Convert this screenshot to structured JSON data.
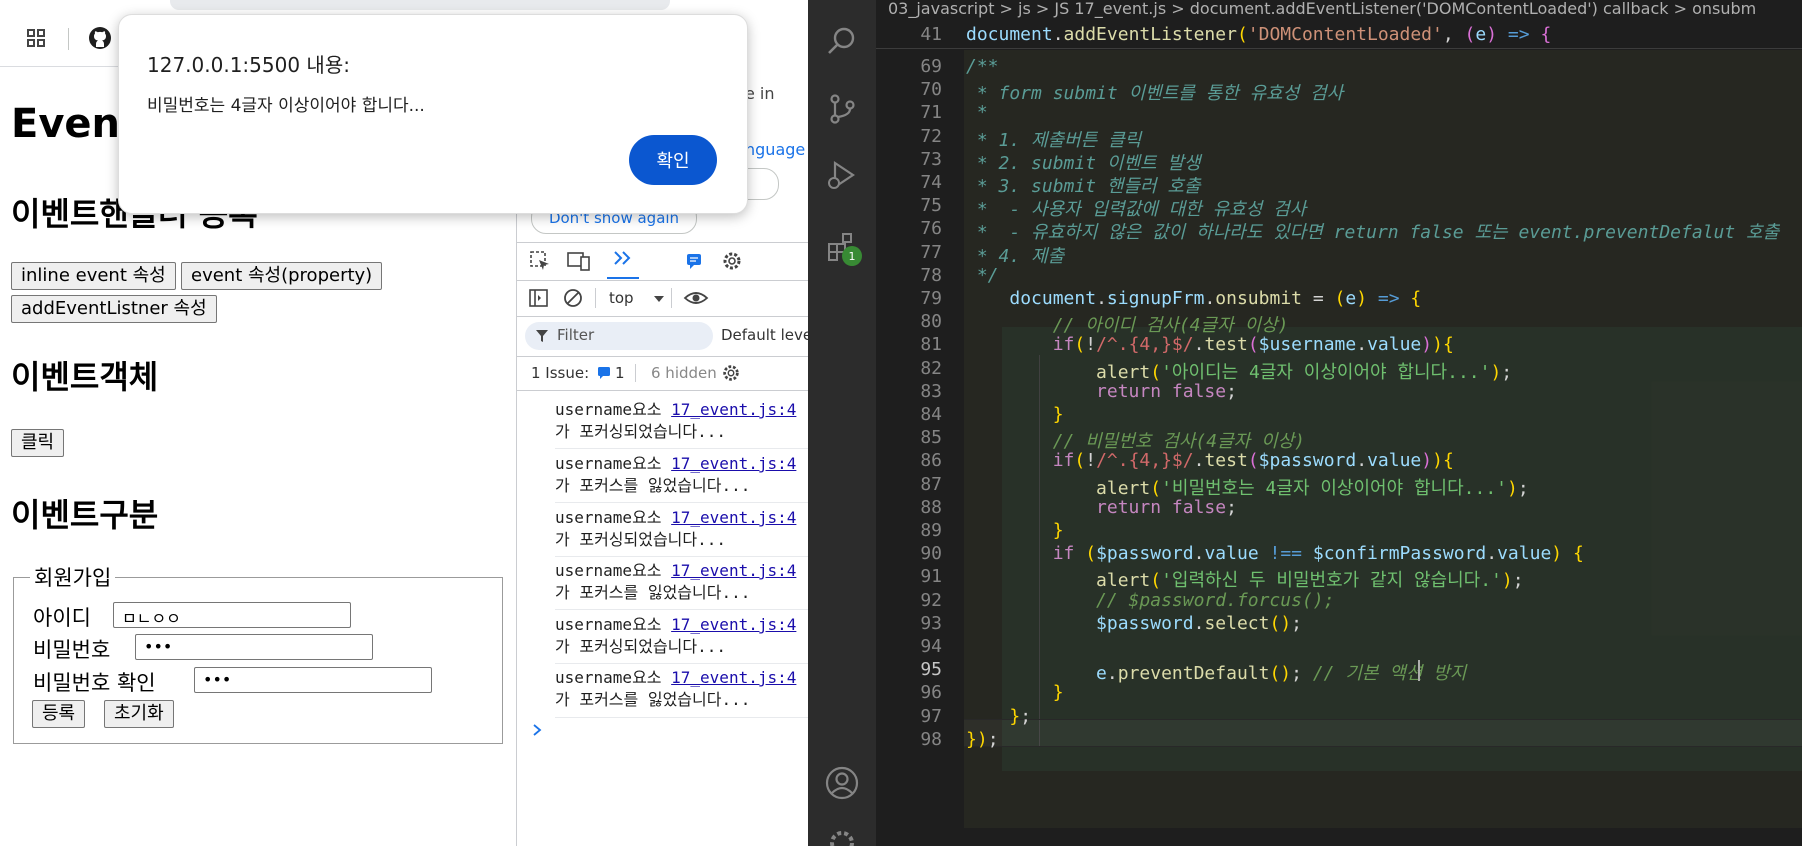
{
  "browser": {
    "toolbar": {
      "apps_icon": "apps-grid-icon",
      "github_icon": "github-icon"
    },
    "page": {
      "title": "Even",
      "heading_handler": "이벤트핸들러 등록",
      "buttons_handler": [
        "inline event 속성",
        "event 속성(property)",
        "addEventListner 속성"
      ],
      "heading_object": "이벤트객체",
      "click_button": "클릭",
      "heading_type": "이벤트구분",
      "form": {
        "legend": "회원가입",
        "username_label": "아이디",
        "username_value": "ㅁㄴㅇㅇ",
        "password_label": "비밀번호",
        "password_value": "•••",
        "confirm_label": "비밀번호 확인",
        "confirm_value": "•••",
        "submit_label": "등록",
        "reset_label": "초기화"
      }
    },
    "alert": {
      "title": "127.0.0.1:5500 내용:",
      "message": "비밀번호는 4글자 이상이어야 합니다...",
      "ok_label": "확인"
    },
    "devtools": {
      "partial_text_1": "e in",
      "partial_text_2": "nguage",
      "dont_show_again": "Don't show again",
      "context": "top",
      "filter_placeholder": "Filter",
      "default_levels": "Default leve",
      "issues_label": "1 Issue:",
      "issues_count": "1",
      "hidden_label": "6 hidden",
      "logs": [
        {
          "prefix": "username요소 ",
          "link": "17_event.js:4",
          "line2": "가 포커싱되었습니다..."
        },
        {
          "prefix": "username요소 ",
          "link": "17_event.js:4",
          "line2": "가 포커스를 잃었습니다..."
        },
        {
          "prefix": "username요소 ",
          "link": "17_event.js:4",
          "line2": "가 포커싱되었습니다..."
        },
        {
          "prefix": "username요소 ",
          "link": "17_event.js:4",
          "line2": "가 포커스를 잃었습니다..."
        },
        {
          "prefix": "username요소 ",
          "link": "17_event.js:4",
          "line2": "가 포커싱되었습니다..."
        },
        {
          "prefix": "username요소 ",
          "link": "17_event.js:4",
          "line2": "가 포커스를 잃었습니다..."
        }
      ]
    }
  },
  "vscode": {
    "breadcrumb": "03_javascript  >  js  >  JS 17_event.js  >  document.addEventListener('DOMContentLoaded') callback  >  onsubm",
    "badge_count": "1",
    "sticky_line_number": "41",
    "sticky_line": "document.addEventListener('DOMContentLoaded', (e) => {",
    "line_numbers": [
      "69",
      "70",
      "71",
      "72",
      "73",
      "74",
      "75",
      "76",
      "77",
      "78",
      "79",
      "80",
      "81",
      "82",
      "83",
      "84",
      "85",
      "86",
      "87",
      "88",
      "89",
      "90",
      "91",
      "92",
      "93",
      "94",
      "95",
      "96",
      "97",
      "98"
    ],
    "code_lines": [
      "/**",
      " * form submit 이벤트를 통한 유효성 검사",
      " *",
      " * 1. 제출버튼 클릭",
      " * 2. submit 이벤트 발생",
      " * 3. submit 핸들러 호출",
      " *  - 사용자 입력값에 대한 유효성 검사",
      " *  - 유효하지 않은 값이 하나라도 있다면 return false 또는 event.preventDefalut 호출",
      " * 4. 제출",
      " */",
      "    document.signupFrm.onsubmit = (e) => {",
      "        // 아이디 검사(4글자 이상)",
      "        if(!/^.{4,}$/.test($username.value)){",
      "            alert('아이디는 4글자 이상이어야 합니다...');",
      "            return false;",
      "        }",
      "        // 비밀번호 검사(4글자 이상)",
      "        if(!/^.{4,}$/.test($password.value)){",
      "            alert('비밀번호는 4글자 이상이어야 합니다...');",
      "            return false;",
      "        }",
      "        if ($password.value !== $confirmPassword.value) {",
      "            alert('입력하신 두 비밀번호가 같지 않습니다.');",
      "            // $password.forcus();",
      "            $password.select();",
      "",
      "            e.preventDefault(); // 기본 액션 방지",
      "        }",
      "    };",
      "});"
    ]
  }
}
